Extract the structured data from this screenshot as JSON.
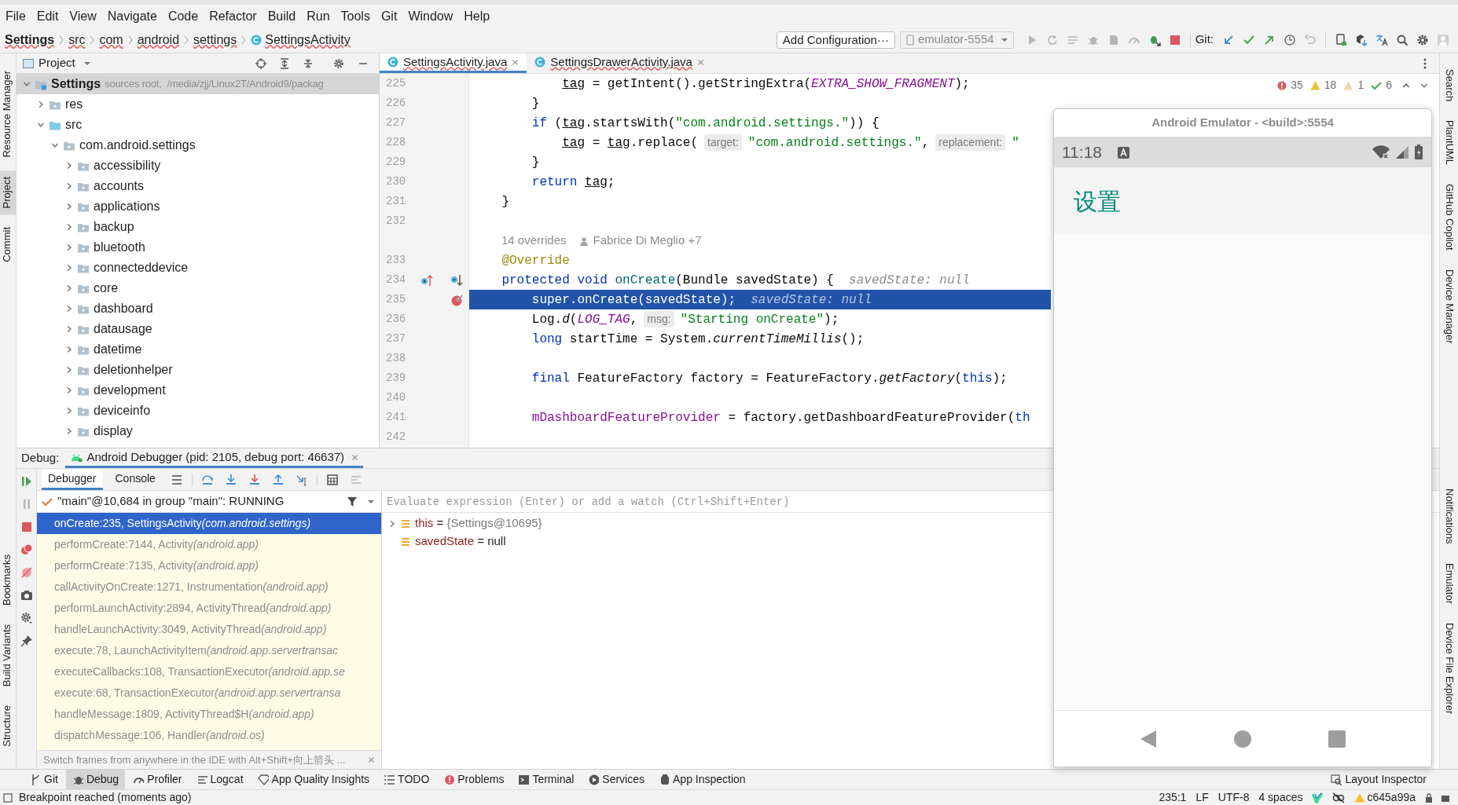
{
  "menu": [
    "File",
    "Edit",
    "View",
    "Navigate",
    "Code",
    "Refactor",
    "Build",
    "Run",
    "Tools",
    "Git",
    "Window",
    "Help"
  ],
  "breadcrumb": [
    {
      "label": "Settings",
      "kind": "root"
    },
    {
      "label": "src",
      "kind": "folder"
    },
    {
      "label": "com",
      "kind": "folder"
    },
    {
      "label": "android",
      "kind": "folder"
    },
    {
      "label": "settings",
      "kind": "folder"
    },
    {
      "label": "SettingsActivity",
      "kind": "class"
    }
  ],
  "toolbar": {
    "run_config": "Add Configuration···",
    "device": "emulator-5554",
    "git_label": "Git:"
  },
  "left_stripe": {
    "top": [
      {
        "label": "Resource Manager",
        "selected": false
      },
      {
        "label": "Project",
        "selected": true
      },
      {
        "label": "Commit",
        "selected": false
      }
    ],
    "bottom": [
      {
        "label": "Bookmarks",
        "selected": false
      },
      {
        "label": "Build Variants",
        "selected": false
      },
      {
        "label": "Structure",
        "selected": false
      }
    ]
  },
  "right_stripe": {
    "top": [
      {
        "label": "Search",
        "selected": false
      },
      {
        "label": "PlantUML",
        "selected": false
      },
      {
        "label": "GitHub Copilot",
        "selected": false
      },
      {
        "label": "Device Manager",
        "selected": false
      }
    ],
    "bottom": [
      {
        "label": "Notifications",
        "selected": false
      },
      {
        "label": "Emulator",
        "selected": false
      },
      {
        "label": "Device File Explorer",
        "selected": false
      }
    ]
  },
  "project": {
    "title": "Project",
    "tree": [
      {
        "label": "Settings",
        "detail": "sources root,  /media/zjj/Linux2T/Android9/packag",
        "kind": "module",
        "expanded": true,
        "selected": true,
        "children": [
          {
            "label": "res",
            "kind": "folder",
            "expanded": false,
            "selected": false
          },
          {
            "label": "src",
            "kind": "source",
            "expanded": true,
            "selected": false,
            "children": [
              {
                "label": "com.android.settings",
                "kind": "package",
                "expanded": true,
                "selected": false,
                "children": [
                  {
                    "label": "accessibility",
                    "kind": "package",
                    "expanded": false,
                    "selected": false
                  },
                  {
                    "label": "accounts",
                    "kind": "package",
                    "expanded": false,
                    "selected": false
                  },
                  {
                    "label": "applications",
                    "kind": "package",
                    "expanded": false,
                    "selected": false
                  },
                  {
                    "label": "backup",
                    "kind": "package",
                    "expanded": false,
                    "selected": false
                  },
                  {
                    "label": "bluetooth",
                    "kind": "package",
                    "expanded": false,
                    "selected": false
                  },
                  {
                    "label": "connecteddevice",
                    "kind": "package",
                    "expanded": false,
                    "selected": false
                  },
                  {
                    "label": "core",
                    "kind": "package",
                    "expanded": false,
                    "selected": false
                  },
                  {
                    "label": "dashboard",
                    "kind": "package",
                    "expanded": false,
                    "selected": false
                  },
                  {
                    "label": "datausage",
                    "kind": "package",
                    "expanded": false,
                    "selected": false
                  },
                  {
                    "label": "datetime",
                    "kind": "package",
                    "expanded": false,
                    "selected": false
                  },
                  {
                    "label": "deletionhelper",
                    "kind": "package",
                    "expanded": false,
                    "selected": false
                  },
                  {
                    "label": "development",
                    "kind": "package",
                    "expanded": false,
                    "selected": false
                  },
                  {
                    "label": "deviceinfo",
                    "kind": "package",
                    "expanded": false,
                    "selected": false
                  },
                  {
                    "label": "display",
                    "kind": "package",
                    "expanded": false,
                    "selected": false
                  }
                ]
              }
            ]
          }
        ]
      }
    ]
  },
  "editor_tabs": [
    {
      "label": "SettingsActivity.java",
      "selected": true
    },
    {
      "label": "SettingsDrawerActivity.java",
      "selected": false
    }
  ],
  "inspections": {
    "errors": "35",
    "warnings": "18",
    "weak_warnings": "1",
    "typos": "6"
  },
  "editor": {
    "lines": [
      {
        "kind": "code",
        "n": "225",
        "current": false,
        "breakpoint": false,
        "overrides": false,
        "tokens": [
          {
            "kind": "variable",
            "text": "            tag"
          },
          {
            "kind": "plain",
            "text": " = getIntent().getStringExtra("
          },
          {
            "kind": "constant",
            "text": "EXTRA_SHOW_FRAGMENT"
          },
          {
            "kind": "plain",
            "text": ");"
          }
        ]
      },
      {
        "kind": "code",
        "n": "226",
        "current": false,
        "breakpoint": false,
        "overrides": false,
        "tokens": [
          {
            "kind": "plain",
            "text": "        }"
          }
        ]
      },
      {
        "kind": "code",
        "n": "227",
        "current": false,
        "breakpoint": false,
        "overrides": false,
        "tokens": [
          {
            "kind": "keyword",
            "text": "        if"
          },
          {
            "kind": "plain",
            "text": " ("
          },
          {
            "kind": "variable",
            "text": "tag"
          },
          {
            "kind": "plain",
            "text": ".startsWith("
          },
          {
            "kind": "string",
            "text": "\"com.android.settings.\""
          },
          {
            "kind": "plain",
            "text": ")) {"
          }
        ]
      },
      {
        "kind": "code",
        "n": "228",
        "current": false,
        "breakpoint": false,
        "overrides": false,
        "tokens": [
          {
            "kind": "variable",
            "text": "            tag"
          },
          {
            "kind": "plain",
            "text": " = "
          },
          {
            "kind": "variable",
            "text": "tag"
          },
          {
            "kind": "plain",
            "text": ".replace("
          },
          {
            "kind": "hint",
            "text": "target:"
          },
          {
            "kind": "string",
            "text": "\"com.android.settings.\""
          },
          {
            "kind": "plain",
            "text": ","
          },
          {
            "kind": "hint",
            "text": "replacement:"
          },
          {
            "kind": "string",
            "text": "\""
          }
        ]
      },
      {
        "kind": "code",
        "n": "229",
        "current": false,
        "breakpoint": false,
        "overrides": false,
        "tokens": [
          {
            "kind": "plain",
            "text": "        }"
          }
        ]
      },
      {
        "kind": "code",
        "n": "230",
        "current": false,
        "breakpoint": false,
        "overrides": false,
        "tokens": [
          {
            "kind": "keyword",
            "text": "        return "
          },
          {
            "kind": "variable",
            "text": "tag"
          },
          {
            "kind": "plain",
            "text": ";"
          }
        ]
      },
      {
        "kind": "code",
        "n": "231",
        "current": false,
        "breakpoint": false,
        "overrides": false,
        "tokens": [
          {
            "kind": "plain",
            "text": "    }"
          }
        ]
      },
      {
        "kind": "code",
        "n": "232",
        "current": false,
        "breakpoint": false,
        "overrides": false
      },
      {
        "kind": "lens",
        "usages": "14 overrides",
        "author": "Fabrice Di Meglio +7"
      },
      {
        "kind": "code",
        "n": "233",
        "current": false,
        "breakpoint": false,
        "overrides": false,
        "tokens": [
          {
            "kind": "annotation",
            "text": "    @Override"
          }
        ]
      },
      {
        "kind": "code",
        "n": "234",
        "current": false,
        "breakpoint": false,
        "overrides": true,
        "tokens": [
          {
            "kind": "keyword",
            "text": "    protected void "
          },
          {
            "kind": "method",
            "text": "onCreate"
          },
          {
            "kind": "plain",
            "text": "(Bundle savedState) {  "
          },
          {
            "kind": "value",
            "text": "savedState: null"
          }
        ]
      },
      {
        "kind": "code",
        "n": "235",
        "current": true,
        "breakpoint": true,
        "overrides": false,
        "tokens": [
          {
            "kind": "plain",
            "text": "        super.onCreate(savedState);  "
          },
          {
            "kind": "value",
            "text": "savedState: null"
          }
        ]
      },
      {
        "kind": "code",
        "n": "236",
        "current": false,
        "breakpoint": false,
        "overrides": false,
        "tokens": [
          {
            "kind": "plain",
            "text": "        Log."
          },
          {
            "kind": "italic",
            "text": "d"
          },
          {
            "kind": "plain",
            "text": "("
          },
          {
            "kind": "constant",
            "text": "LOG_TAG"
          },
          {
            "kind": "plain",
            "text": ","
          },
          {
            "kind": "hint",
            "text": "msg:"
          },
          {
            "kind": "string",
            "text": "\"Starting onCreate\""
          },
          {
            "kind": "plain",
            "text": ");"
          }
        ]
      },
      {
        "kind": "code",
        "n": "237",
        "current": false,
        "breakpoint": false,
        "overrides": false,
        "tokens": [
          {
            "kind": "keyword",
            "text": "        long "
          },
          {
            "kind": "plain",
            "text": "startTime = System."
          },
          {
            "kind": "italic",
            "text": "currentTimeMillis"
          },
          {
            "kind": "plain",
            "text": "();"
          }
        ]
      },
      {
        "kind": "code",
        "n": "238",
        "current": false,
        "breakpoint": false,
        "overrides": false
      },
      {
        "kind": "code",
        "n": "239",
        "current": false,
        "breakpoint": false,
        "overrides": false,
        "tokens": [
          {
            "kind": "keyword",
            "text": "        final "
          },
          {
            "kind": "plain",
            "text": "FeatureFactory factory = FeatureFactory."
          },
          {
            "kind": "italic",
            "text": "getFactory"
          },
          {
            "kind": "plain",
            "text": "("
          },
          {
            "kind": "keyword",
            "text": "this"
          },
          {
            "kind": "plain",
            "text": ");"
          }
        ]
      },
      {
        "kind": "code",
        "n": "240",
        "current": false,
        "breakpoint": false,
        "overrides": false
      },
      {
        "kind": "code",
        "n": "241",
        "current": false,
        "breakpoint": false,
        "overrides": false,
        "tokens": [
          {
            "kind": "field",
            "text": "        mDashboardFeatureProvider"
          },
          {
            "kind": "plain",
            "text": " = factory.getDashboardFeatureProvider("
          },
          {
            "kind": "keyword",
            "text": "th"
          }
        ]
      },
      {
        "kind": "code",
        "n": "242",
        "current": false,
        "breakpoint": false,
        "overrides": false
      }
    ]
  },
  "debugger": {
    "label": "Debug:",
    "session": "Android Debugger (pid: 2105, debug port: 46637)",
    "tabs": [
      {
        "label": "Debugger",
        "selected": true
      },
      {
        "label": "Console",
        "selected": false
      }
    ],
    "thread": "\"main\"@10,684 in group \"main\": RUNNING",
    "frames": [
      {
        "method": "onCreate:235, SettingsActivity",
        "package": "(com.android.settings)",
        "selected": true,
        "library": false
      },
      {
        "method": "performCreate:7144, Activity",
        "package": "(android.app)",
        "selected": false,
        "library": true
      },
      {
        "method": "performCreate:7135, Activity",
        "package": "(android.app)",
        "selected": false,
        "library": true
      },
      {
        "method": "callActivityOnCreate:1271, Instrumentation",
        "package": "(android.app)",
        "selected": false,
        "library": true
      },
      {
        "method": "performLaunchActivity:2894, ActivityThread",
        "package": "(android.app)",
        "selected": false,
        "library": true
      },
      {
        "method": "handleLaunchActivity:3049, ActivityThread",
        "package": "(android.app)",
        "selected": false,
        "library": true
      },
      {
        "method": "execute:78, LaunchActivityItem",
        "package": "(android.app.servertransac",
        "selected": false,
        "library": true
      },
      {
        "method": "executeCallbacks:108, TransactionExecutor",
        "package": "(android.app.se",
        "selected": false,
        "library": true
      },
      {
        "method": "execute:68, TransactionExecutor",
        "package": "(android.app.servertransa",
        "selected": false,
        "library": true
      },
      {
        "method": "handleMessage:1809, ActivityThread$H",
        "package": "(android.app)",
        "selected": false,
        "library": true
      },
      {
        "method": "dispatchMessage:106, Handler",
        "package": "(android.os)",
        "selected": false,
        "library": true
      }
    ],
    "hint": "Switch frames from anywhere in the IDE with Alt+Shift+向上箭头 ...",
    "evaluate_placeholder": "Evaluate expression (Enter) or add a watch (Ctrl+Shift+Enter)",
    "variables": [
      {
        "name": "this",
        "operator": "=",
        "value": "{Settings@10695}",
        "expandable": true
      },
      {
        "name": "savedState",
        "operator": "=",
        "value": "null",
        "expandable": false
      }
    ]
  },
  "emulator": {
    "title": "Android Emulator - <build>:5554",
    "time": "11:18",
    "app_title": "设置"
  },
  "bottom_tools": [
    {
      "label": "Git",
      "selected": false
    },
    {
      "label": "Debug",
      "selected": true
    },
    {
      "label": "Profiler",
      "selected": false
    },
    {
      "label": "Logcat",
      "selected": false
    },
    {
      "label": "App Quality Insights",
      "selected": false
    },
    {
      "label": "TODO",
      "selected": false
    },
    {
      "label": "Problems",
      "selected": false
    },
    {
      "label": "Terminal",
      "selected": false
    },
    {
      "label": "Services",
      "selected": false
    },
    {
      "label": "App Inspection",
      "selected": false
    }
  ],
  "bottom_right_tool": "Layout Inspector",
  "status": {
    "message": "Breakpoint reached (moments ago)",
    "items": [
      "235:1",
      "LF",
      "UTF-8",
      "4 spaces"
    ],
    "branch": "c645a99a"
  }
}
